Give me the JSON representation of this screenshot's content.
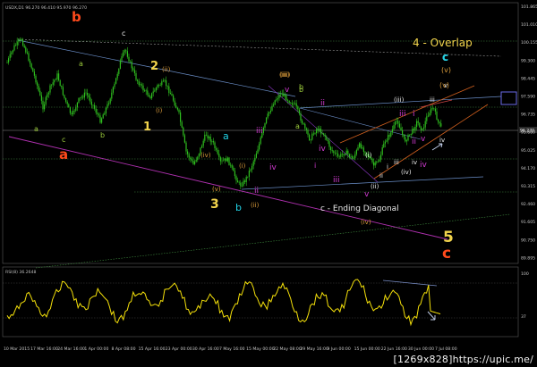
{
  "chart_data": [
    {
      "type": "candlestick",
      "panel": "price",
      "header_text": "USDX,D1  96.270  96.410  95.970  96.270",
      "current_price": "96.270",
      "x_tick_labels": [
        "10 Mar 2015",
        "17 Mar 16:00",
        "24 Mar 16:00",
        "1 Apr 00:00",
        "8 Apr 08:00",
        "15 Apr 16:00",
        "23 Apr 00:00",
        "30 Apr 16:00",
        "7 May 16:00",
        "15 May 00:00",
        "22 May 08:00",
        "29 May 16:00",
        "9 Jun 00:00",
        "15 Jun 00:00",
        "22 Jun 16:00",
        "30 Jun 00:00",
        "7 Jul 08:00"
      ],
      "y_tick_labels": [
        "101.865",
        "101.010",
        "100.155",
        "99.300",
        "98.445",
        "97.590",
        "96.735",
        "95.880",
        "95.025",
        "94.170",
        "93.315",
        "92.460",
        "91.605",
        "90.750",
        "89.895"
      ],
      "ylim": [
        89.8,
        101.9
      ],
      "wave_labels": [
        {
          "text": "a",
          "color": "#9ccc3c"
        },
        {
          "text": "a",
          "color": "#9ccc3c"
        },
        {
          "text": "b",
          "color": "#9ccc3c"
        },
        {
          "text": "c",
          "color": "#9ccc3c"
        },
        {
          "text": "c",
          "color": "#e8e8e8"
        },
        {
          "text": "b",
          "color": "#9ccc3c"
        },
        {
          "text": "b",
          "color": "#ff4a1c"
        },
        {
          "text": "a",
          "color": "#ff4a1c"
        },
        {
          "text": "c",
          "color": "#e8e8e8"
        },
        {
          "text": "2",
          "color": "#f2d44c"
        },
        {
          "text": "(ii)",
          "color": "#d89a3a"
        },
        {
          "text": "(i)",
          "color": "#d89a3a"
        },
        {
          "text": "1",
          "color": "#f2d44c"
        },
        {
          "text": "(iii)",
          "color": "#d89a3a"
        },
        {
          "text": "(iv)",
          "color": "#d89a3a"
        },
        {
          "text": "(v)",
          "color": "#d89a3a"
        },
        {
          "text": "3",
          "color": "#f2d44c"
        },
        {
          "text": "a",
          "color": "#22d3e6"
        },
        {
          "text": "b",
          "color": "#22d3e6"
        },
        {
          "text": "(i)",
          "color": "#d89a3a"
        },
        {
          "text": "(ii)",
          "color": "#d89a3a"
        },
        {
          "text": "ii",
          "color": "#d23ad2"
        },
        {
          "text": "iii",
          "color": "#d23ad2"
        },
        {
          "text": "iv",
          "color": "#d23ad2"
        },
        {
          "text": "(iii)",
          "color": "#d89a3a"
        },
        {
          "text": "v",
          "color": "#d23ad2"
        },
        {
          "text": "b",
          "color": "#9ccc3c"
        },
        {
          "text": "a",
          "color": "#9ccc3c"
        },
        {
          "text": "ii",
          "color": "#d23ad2"
        },
        {
          "text": "i",
          "color": "#d23ad2"
        },
        {
          "text": "iii",
          "color": "#d23ad2"
        },
        {
          "text": "iv",
          "color": "#d23ad2"
        },
        {
          "text": "v",
          "color": "#d23ad2"
        },
        {
          "text": "(iv)",
          "color": "#d89a3a"
        },
        {
          "text": "(i)",
          "color": "#e8e8e8"
        },
        {
          "text": "(ii)",
          "color": "#e8e8e8"
        },
        {
          "text": "(iii)",
          "color": "#e8e8e8"
        },
        {
          "text": "(iv)",
          "color": "#e8e8e8"
        },
        {
          "text": "i",
          "color": "#e8e8e8"
        },
        {
          "text": "ii",
          "color": "#e8e8e8"
        },
        {
          "text": "iii",
          "color": "#e8e8e8"
        },
        {
          "text": "iv",
          "color": "#e8e8e8"
        },
        {
          "text": "iii",
          "color": "#d23ad2"
        },
        {
          "text": "i",
          "color": "#d23ad2"
        },
        {
          "text": "ii",
          "color": "#d23ad2"
        },
        {
          "text": "iv",
          "color": "#d23ad2"
        },
        {
          "text": "v",
          "color": "#d23ad2"
        },
        {
          "text": "(v)",
          "color": "#d89a3a"
        },
        {
          "text": "(v)",
          "color": "#d89a3a"
        },
        {
          "text": "iii",
          "color": "#e8e8e8"
        },
        {
          "text": "v",
          "color": "#e8e8e8"
        },
        {
          "text": "iv",
          "color": "#e8e8e8"
        },
        {
          "text": "5",
          "color": "#f2d44c"
        },
        {
          "text": "c",
          "color": "#ff4a1c"
        }
      ],
      "annotations": [
        {
          "text": "4 - Overlap",
          "color": "#f2d44c"
        },
        {
          "text": "c - Ending Diagonal",
          "color": "#e8e8e8"
        },
        {
          "text": "c",
          "color": "#22d3e6"
        }
      ],
      "colors": {
        "background": "#000000",
        "candles": "#2fbf1f",
        "channel_purple": "#b030b0",
        "channel_steel": "#6a8ec8",
        "channel_orange": "#d2601e",
        "dotted_green": "#3e8a3e",
        "box": "#6a6ae6"
      }
    },
    {
      "type": "line",
      "panel": "oscillator",
      "header_text": "RSI(8) 36.2648",
      "y_tick_labels": [
        "100",
        "37"
      ],
      "ylim": [
        0,
        100
      ],
      "series": [
        {
          "color": "#f5e10a"
        }
      ]
    }
  ],
  "watermark": "[1269x828]https://upic.me/"
}
